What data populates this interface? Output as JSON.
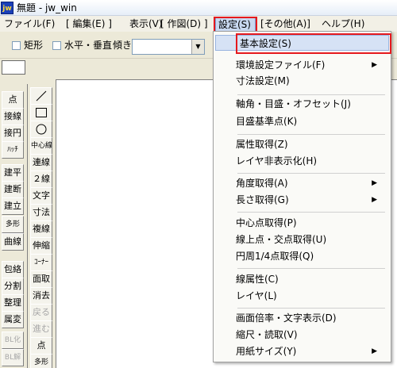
{
  "window": {
    "title": "無題 - jw_win",
    "app_icon_text": "jw"
  },
  "menubar": [
    {
      "label": "ファイル(F)"
    },
    {
      "label": "[ 編集(E) ]"
    },
    {
      "label": "表示(V)"
    },
    {
      "label": "[ 作図(D) ]"
    },
    {
      "label": "設定(S)"
    },
    {
      "label": "[その他(A)]"
    },
    {
      "label": "ヘルプ(H)"
    }
  ],
  "toolbar": {
    "rect_label": "矩形",
    "hv_label": "水平・垂直",
    "tilt_label": "傾き",
    "tilt_value": "",
    "combo_arrow": "▼"
  },
  "left_panel_1": [
    "点",
    "接線",
    "接円",
    "ﾊｯﾁ",
    "建平",
    "建断",
    "建立",
    "多形",
    "曲線",
    "包絡",
    "分割",
    "整理",
    "属変",
    "BL化",
    "BL解"
  ],
  "left_panel_2": [
    "中心線",
    "連線",
    "２線",
    "文字",
    "寸法",
    "複線",
    "伸縮",
    "ｺｰﾅｰ",
    "面取",
    "消去",
    "戻る",
    "進む",
    "点",
    "多形"
  ],
  "settings_menu": {
    "items": [
      {
        "label": "基本設定(S)",
        "submenu": false,
        "selected": true
      },
      {
        "label": "環境設定ファイル(F)",
        "submenu": true
      },
      {
        "label": "寸法設定(M)",
        "submenu": false
      },
      {
        "label": "軸角・目盛・オフセット(J)",
        "submenu": false
      },
      {
        "label": "目盛基準点(K)",
        "submenu": false
      },
      {
        "label": "属性取得(Z)",
        "submenu": false
      },
      {
        "label": "レイヤ非表示化(H)",
        "submenu": false
      },
      {
        "label": "角度取得(A)",
        "submenu": true
      },
      {
        "label": "長さ取得(G)",
        "submenu": true
      },
      {
        "label": "中心点取得(P)",
        "submenu": false
      },
      {
        "label": "線上点・交点取得(U)",
        "submenu": false
      },
      {
        "label": "円周1/4点取得(Q)",
        "submenu": false
      },
      {
        "label": "線属性(C)",
        "submenu": false
      },
      {
        "label": "レイヤ(L)",
        "submenu": false
      },
      {
        "label": "画面倍率・文字表示(D)",
        "submenu": false
      },
      {
        "label": "縮尺・読取(V)",
        "submenu": false
      },
      {
        "label": "用紙サイズ(Y)",
        "submenu": true
      }
    ],
    "arrow": "▶"
  },
  "colors": {
    "highlight": "#e5191e",
    "menu_selected": "#d6e2f5"
  }
}
